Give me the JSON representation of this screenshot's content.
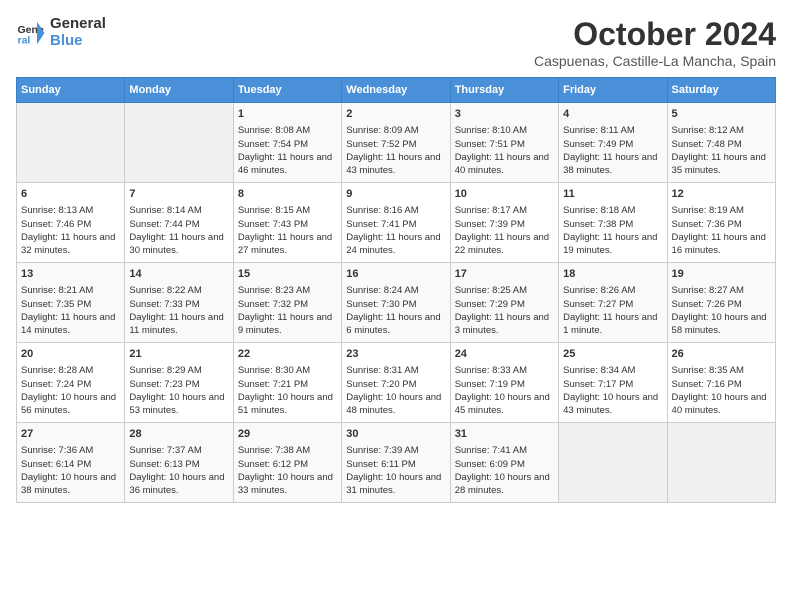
{
  "logo": {
    "line1": "General",
    "line2": "Blue"
  },
  "title": "October 2024",
  "location": "Caspuenas, Castille-La Mancha, Spain",
  "days_of_week": [
    "Sunday",
    "Monday",
    "Tuesday",
    "Wednesday",
    "Thursday",
    "Friday",
    "Saturday"
  ],
  "weeks": [
    [
      {
        "day": "",
        "sunrise": "",
        "sunset": "",
        "daylight": ""
      },
      {
        "day": "",
        "sunrise": "",
        "sunset": "",
        "daylight": ""
      },
      {
        "day": "1",
        "sunrise": "Sunrise: 8:08 AM",
        "sunset": "Sunset: 7:54 PM",
        "daylight": "Daylight: 11 hours and 46 minutes."
      },
      {
        "day": "2",
        "sunrise": "Sunrise: 8:09 AM",
        "sunset": "Sunset: 7:52 PM",
        "daylight": "Daylight: 11 hours and 43 minutes."
      },
      {
        "day": "3",
        "sunrise": "Sunrise: 8:10 AM",
        "sunset": "Sunset: 7:51 PM",
        "daylight": "Daylight: 11 hours and 40 minutes."
      },
      {
        "day": "4",
        "sunrise": "Sunrise: 8:11 AM",
        "sunset": "Sunset: 7:49 PM",
        "daylight": "Daylight: 11 hours and 38 minutes."
      },
      {
        "day": "5",
        "sunrise": "Sunrise: 8:12 AM",
        "sunset": "Sunset: 7:48 PM",
        "daylight": "Daylight: 11 hours and 35 minutes."
      }
    ],
    [
      {
        "day": "6",
        "sunrise": "Sunrise: 8:13 AM",
        "sunset": "Sunset: 7:46 PM",
        "daylight": "Daylight: 11 hours and 32 minutes."
      },
      {
        "day": "7",
        "sunrise": "Sunrise: 8:14 AM",
        "sunset": "Sunset: 7:44 PM",
        "daylight": "Daylight: 11 hours and 30 minutes."
      },
      {
        "day": "8",
        "sunrise": "Sunrise: 8:15 AM",
        "sunset": "Sunset: 7:43 PM",
        "daylight": "Daylight: 11 hours and 27 minutes."
      },
      {
        "day": "9",
        "sunrise": "Sunrise: 8:16 AM",
        "sunset": "Sunset: 7:41 PM",
        "daylight": "Daylight: 11 hours and 24 minutes."
      },
      {
        "day": "10",
        "sunrise": "Sunrise: 8:17 AM",
        "sunset": "Sunset: 7:39 PM",
        "daylight": "Daylight: 11 hours and 22 minutes."
      },
      {
        "day": "11",
        "sunrise": "Sunrise: 8:18 AM",
        "sunset": "Sunset: 7:38 PM",
        "daylight": "Daylight: 11 hours and 19 minutes."
      },
      {
        "day": "12",
        "sunrise": "Sunrise: 8:19 AM",
        "sunset": "Sunset: 7:36 PM",
        "daylight": "Daylight: 11 hours and 16 minutes."
      }
    ],
    [
      {
        "day": "13",
        "sunrise": "Sunrise: 8:21 AM",
        "sunset": "Sunset: 7:35 PM",
        "daylight": "Daylight: 11 hours and 14 minutes."
      },
      {
        "day": "14",
        "sunrise": "Sunrise: 8:22 AM",
        "sunset": "Sunset: 7:33 PM",
        "daylight": "Daylight: 11 hours and 11 minutes."
      },
      {
        "day": "15",
        "sunrise": "Sunrise: 8:23 AM",
        "sunset": "Sunset: 7:32 PM",
        "daylight": "Daylight: 11 hours and 9 minutes."
      },
      {
        "day": "16",
        "sunrise": "Sunrise: 8:24 AM",
        "sunset": "Sunset: 7:30 PM",
        "daylight": "Daylight: 11 hours and 6 minutes."
      },
      {
        "day": "17",
        "sunrise": "Sunrise: 8:25 AM",
        "sunset": "Sunset: 7:29 PM",
        "daylight": "Daylight: 11 hours and 3 minutes."
      },
      {
        "day": "18",
        "sunrise": "Sunrise: 8:26 AM",
        "sunset": "Sunset: 7:27 PM",
        "daylight": "Daylight: 11 hours and 1 minute."
      },
      {
        "day": "19",
        "sunrise": "Sunrise: 8:27 AM",
        "sunset": "Sunset: 7:26 PM",
        "daylight": "Daylight: 10 hours and 58 minutes."
      }
    ],
    [
      {
        "day": "20",
        "sunrise": "Sunrise: 8:28 AM",
        "sunset": "Sunset: 7:24 PM",
        "daylight": "Daylight: 10 hours and 56 minutes."
      },
      {
        "day": "21",
        "sunrise": "Sunrise: 8:29 AM",
        "sunset": "Sunset: 7:23 PM",
        "daylight": "Daylight: 10 hours and 53 minutes."
      },
      {
        "day": "22",
        "sunrise": "Sunrise: 8:30 AM",
        "sunset": "Sunset: 7:21 PM",
        "daylight": "Daylight: 10 hours and 51 minutes."
      },
      {
        "day": "23",
        "sunrise": "Sunrise: 8:31 AM",
        "sunset": "Sunset: 7:20 PM",
        "daylight": "Daylight: 10 hours and 48 minutes."
      },
      {
        "day": "24",
        "sunrise": "Sunrise: 8:33 AM",
        "sunset": "Sunset: 7:19 PM",
        "daylight": "Daylight: 10 hours and 45 minutes."
      },
      {
        "day": "25",
        "sunrise": "Sunrise: 8:34 AM",
        "sunset": "Sunset: 7:17 PM",
        "daylight": "Daylight: 10 hours and 43 minutes."
      },
      {
        "day": "26",
        "sunrise": "Sunrise: 8:35 AM",
        "sunset": "Sunset: 7:16 PM",
        "daylight": "Daylight: 10 hours and 40 minutes."
      }
    ],
    [
      {
        "day": "27",
        "sunrise": "Sunrise: 7:36 AM",
        "sunset": "Sunset: 6:14 PM",
        "daylight": "Daylight: 10 hours and 38 minutes."
      },
      {
        "day": "28",
        "sunrise": "Sunrise: 7:37 AM",
        "sunset": "Sunset: 6:13 PM",
        "daylight": "Daylight: 10 hours and 36 minutes."
      },
      {
        "day": "29",
        "sunrise": "Sunrise: 7:38 AM",
        "sunset": "Sunset: 6:12 PM",
        "daylight": "Daylight: 10 hours and 33 minutes."
      },
      {
        "day": "30",
        "sunrise": "Sunrise: 7:39 AM",
        "sunset": "Sunset: 6:11 PM",
        "daylight": "Daylight: 10 hours and 31 minutes."
      },
      {
        "day": "31",
        "sunrise": "Sunrise: 7:41 AM",
        "sunset": "Sunset: 6:09 PM",
        "daylight": "Daylight: 10 hours and 28 minutes."
      },
      {
        "day": "",
        "sunrise": "",
        "sunset": "",
        "daylight": ""
      },
      {
        "day": "",
        "sunrise": "",
        "sunset": "",
        "daylight": ""
      }
    ]
  ]
}
